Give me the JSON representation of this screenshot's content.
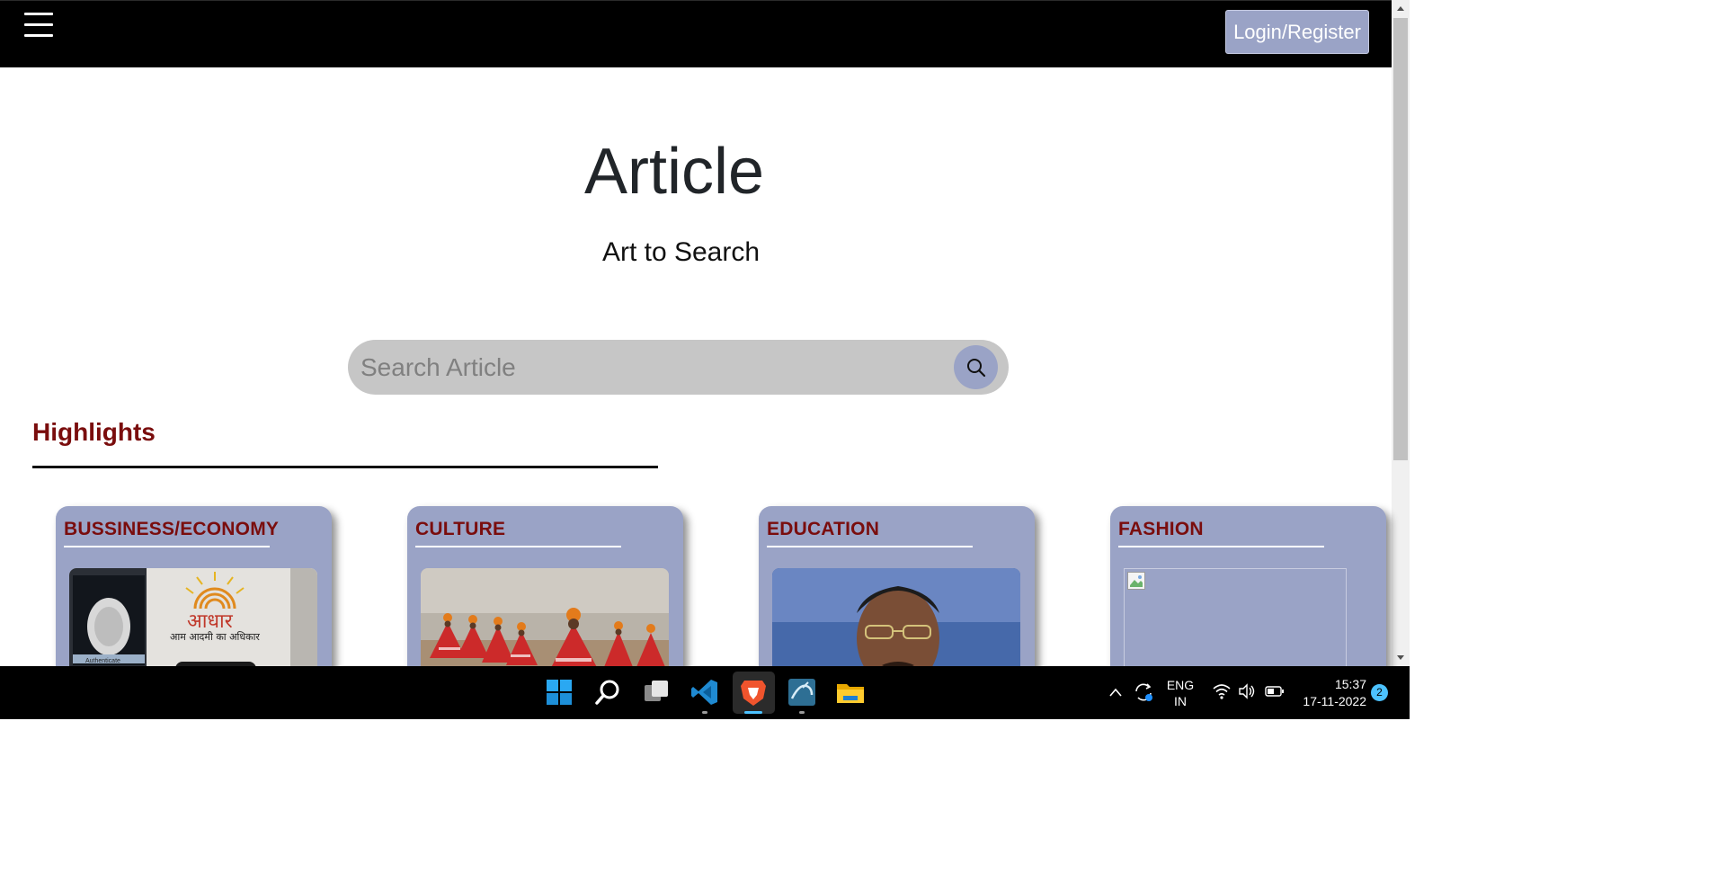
{
  "navbar": {
    "login_label": "Login/Register"
  },
  "hero": {
    "title": "Article",
    "subtitle": "Art to Search"
  },
  "search": {
    "placeholder": "Search Article",
    "value": ""
  },
  "highlights": {
    "title": "Highlights",
    "cards": [
      {
        "category": "BUSSINESS/ECONOMY",
        "image": "aadhaar-fingerprint-photo",
        "image_text_1": "आधार",
        "image_text_2": "आम आदमी का अधिकार",
        "image_text_3": "Authenticate"
      },
      {
        "category": "CULTURE",
        "image": "folk-dancers-photo"
      },
      {
        "category": "EDUCATION",
        "image": "speaker-at-microphone-photo"
      },
      {
        "category": "FASHION",
        "image": "broken-image-icon"
      }
    ]
  },
  "taskbar": {
    "apps": [
      "windows-start-icon",
      "search-icon",
      "task-view-icon",
      "vscode-icon",
      "brave-browser-icon",
      "mysql-workbench-icon",
      "file-explorer-icon"
    ],
    "language_line1": "ENG",
    "language_line2": "IN",
    "time": "15:37",
    "date": "17-11-2022",
    "notification_count": "2"
  },
  "colors": {
    "accent": "#9aa3c6",
    "heading_red": "#7a0d0d",
    "navbar_bg": "#000000",
    "search_bg": "#c6c6c6"
  }
}
